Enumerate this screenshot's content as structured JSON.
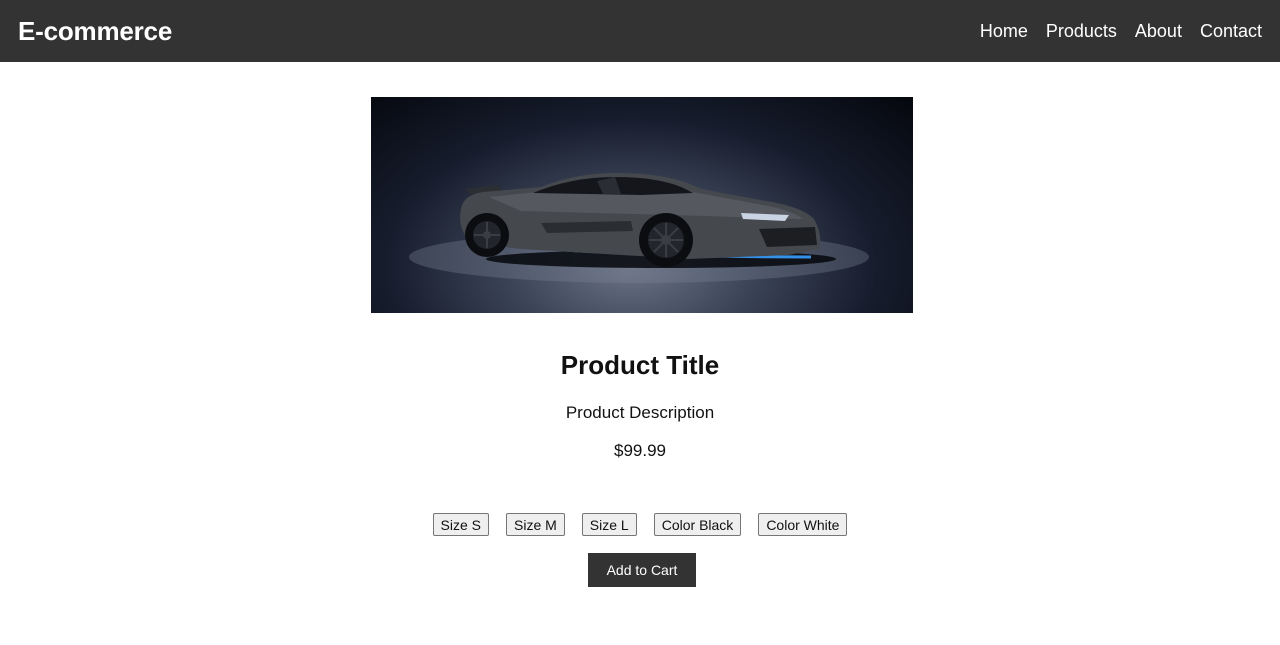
{
  "brand": {
    "name": "E-commerce"
  },
  "nav": {
    "items": [
      {
        "label": "Home"
      },
      {
        "label": "Products"
      },
      {
        "label": "About"
      },
      {
        "label": "Contact"
      }
    ]
  },
  "product": {
    "image_alt": "Product image: dark grey sports car with blue accent lighting",
    "title": "Product Title",
    "description": "Product Description",
    "price": "$99.99"
  },
  "options": [
    {
      "label": "Size S"
    },
    {
      "label": "Size M"
    },
    {
      "label": "Size L"
    },
    {
      "label": "Color Black"
    },
    {
      "label": "Color White"
    }
  ],
  "actions": {
    "add_to_cart": "Add to Cart"
  },
  "colors": {
    "header_bg": "#333333",
    "header_text": "#ffffff",
    "button_bg": "#333333",
    "accent_underglow": "#3aa0ff"
  },
  "icons": {
    "product_image": "car-photo"
  }
}
